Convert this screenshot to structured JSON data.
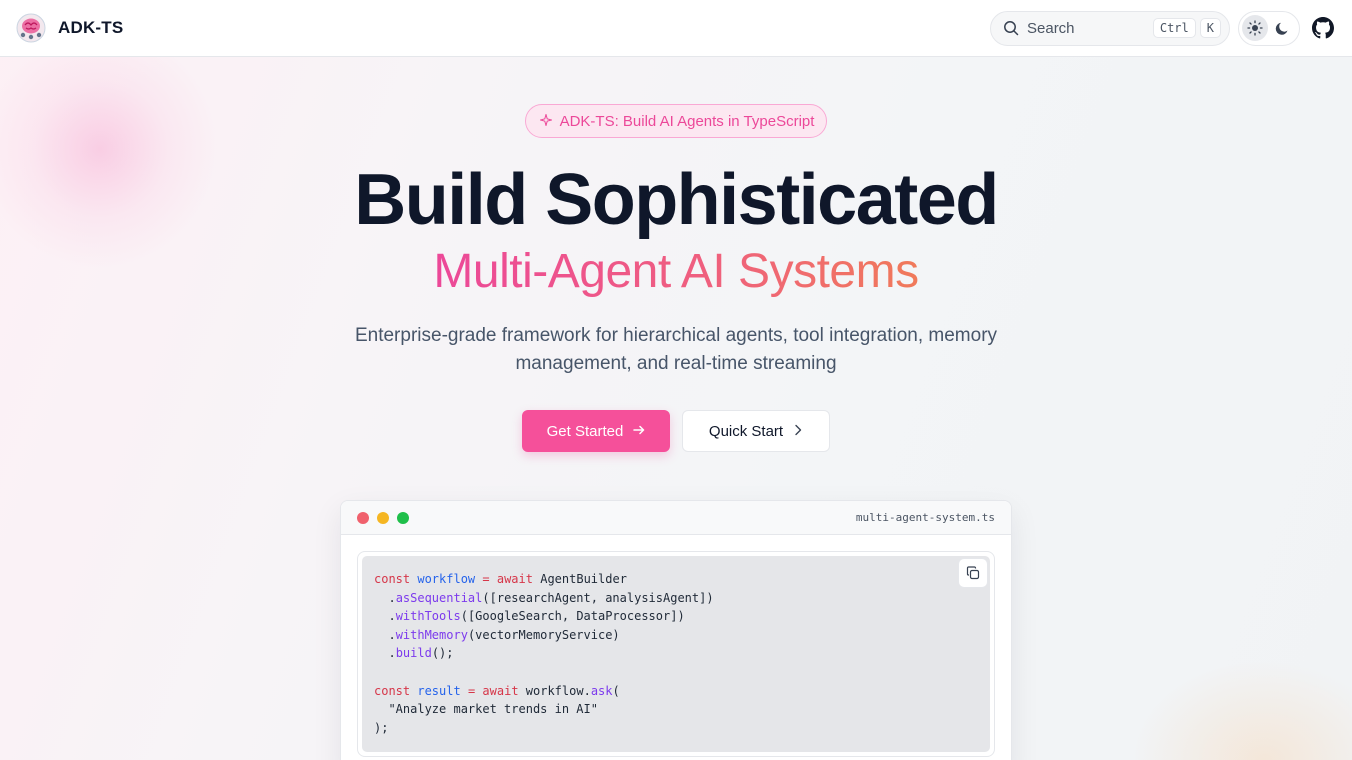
{
  "header": {
    "brand": "ADK-TS",
    "search_label": "Search",
    "shortcut_keys": [
      "Ctrl",
      "K"
    ],
    "theme_options": [
      "light",
      "dark"
    ],
    "theme_active": "light"
  },
  "hero": {
    "badge": "ADK-TS: Build AI Agents in TypeScript",
    "headline": "Build Sophisticated",
    "subheadline": "Multi-Agent AI Systems",
    "description_line1": "Enterprise-grade framework for hierarchical agents, tool integration, memory",
    "description_line2": "management, and real-time streaming",
    "primary_cta": "Get Started",
    "secondary_cta": "Quick Start"
  },
  "code_window": {
    "filename": "multi-agent-system.ts",
    "traffic_light_colors": [
      "#f0616d",
      "#f5b622",
      "#1fbf4a"
    ],
    "tokens": {
      "l1": [
        "const",
        "workflow",
        "=",
        "await",
        "AgentBuilder"
      ],
      "l2": [
        ".",
        "asSequential",
        "([researchAgent, analysisAgent])"
      ],
      "l3": [
        ".",
        "withTools",
        "([GoogleSearch, DataProcessor])"
      ],
      "l4": [
        ".",
        "withMemory",
        "(vectorMemoryService)"
      ],
      "l5": [
        ".",
        "build",
        "();"
      ],
      "l7": [
        "const",
        "result",
        "=",
        "await",
        "workflow.",
        "ask",
        "("
      ],
      "l8": [
        "\"Analyze market trends in AI\""
      ],
      "l9": [
        ");"
      ]
    }
  },
  "colors": {
    "brand_pink": "#f5509a",
    "heading": "#0f172a",
    "muted": "#475569"
  }
}
